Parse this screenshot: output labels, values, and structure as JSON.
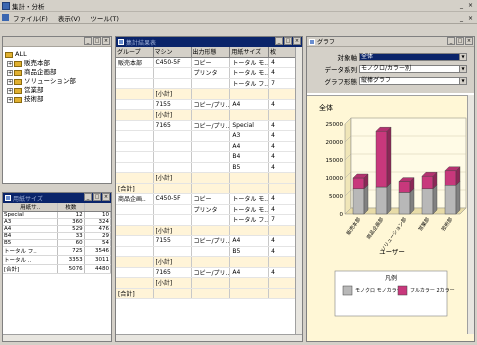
{
  "app": {
    "title": "集計・分析"
  },
  "menu": [
    "ファイル(F)",
    "表示(V)",
    "ツール(T)"
  ],
  "tree_window": {
    "nodes": [
      {
        "label": "ALL",
        "expander": ""
      },
      {
        "label": "販売本部",
        "expander": "+"
      },
      {
        "label": "商品企画部",
        "expander": "+"
      },
      {
        "label": "ソリューション部",
        "expander": "+"
      },
      {
        "label": "営業部",
        "expander": "+"
      },
      {
        "label": "技術部",
        "expander": "+"
      }
    ]
  },
  "summary_window": {
    "title": "用紙サイズ",
    "headers": [
      "用紙サ..",
      "枚数",
      ""
    ],
    "rows": [
      [
        "Special",
        "12",
        "10"
      ],
      [
        "A3",
        "360",
        "324"
      ],
      [
        "A4",
        "529",
        "476"
      ],
      [
        "B4",
        "33",
        "29"
      ],
      [
        "B5",
        "60",
        "54"
      ],
      [
        "トータル フ..",
        "725",
        "3546"
      ],
      [
        "トータル ..",
        "3353",
        "3011"
      ],
      [
        "[合計]",
        "5076",
        "4480"
      ]
    ]
  },
  "detail_window": {
    "title": "集計結果表",
    "headers": [
      "グループ",
      "マシン",
      "出力形態",
      "用紙サイズ",
      "枚"
    ],
    "rows": [
      [
        "販売本部",
        "C450-5F",
        "コピー",
        "トータル モ..",
        "4"
      ],
      [
        "",
        "",
        "プリンタ",
        "トータル モ..",
        "4"
      ],
      [
        "",
        "",
        "",
        "トータル フ..",
        "7"
      ],
      [
        "",
        "[小計]",
        "",
        "",
        ""
      ],
      [
        "",
        "7155",
        "コピー/プリ..",
        "A4",
        "4"
      ],
      [
        "",
        "[小計]",
        "",
        "",
        ""
      ],
      [
        "",
        "7165",
        "コピー/プリ..",
        "Special",
        "4"
      ],
      [
        "",
        "",
        "",
        "A3",
        "4"
      ],
      [
        "",
        "",
        "",
        "A4",
        "4"
      ],
      [
        "",
        "",
        "",
        "B4",
        "4"
      ],
      [
        "",
        "",
        "",
        "B5",
        "4"
      ],
      [
        "",
        "[小計]",
        "",
        "",
        ""
      ],
      [
        "[合計]",
        "",
        "",
        "",
        ""
      ],
      [
        "商品企画..",
        "C450-5F",
        "コピー",
        "トータル モ..",
        "4"
      ],
      [
        "",
        "",
        "プリンタ",
        "トータル モ..",
        "4"
      ],
      [
        "",
        "",
        "",
        "トータル フ..",
        "7"
      ],
      [
        "",
        "[小計]",
        "",
        "",
        ""
      ],
      [
        "",
        "7155",
        "コピー/プリ..",
        "A4",
        "4"
      ],
      [
        "",
        "",
        "",
        "B5",
        "4"
      ],
      [
        "",
        "[小計]",
        "",
        "",
        ""
      ],
      [
        "",
        "7165",
        "コピー/プリ..",
        "A4",
        "4"
      ],
      [
        "",
        "[小計]",
        "",
        "",
        ""
      ],
      [
        "[合計]",
        "",
        "",
        "",
        ""
      ]
    ]
  },
  "graph_window": {
    "title": "グラフ",
    "controls": [
      {
        "label": "対象軸",
        "value": "全体",
        "highlight": true
      },
      {
        "label": "データ系列",
        "value": "モノクロ/カラー別",
        "highlight": false
      },
      {
        "label": "グラフ形態",
        "value": "縦棒グラフ",
        "highlight": false
      }
    ]
  },
  "chart_data": {
    "type": "bar",
    "title": "全体",
    "xlabel": "ユーザー",
    "ylabel": "",
    "ylim": [
      0,
      25000
    ],
    "yticks": [
      0,
      5000,
      10000,
      15000,
      20000,
      25000
    ],
    "categories": [
      "販売本部",
      "商品企画部",
      "ソリューション部",
      "営業部",
      "技術部"
    ],
    "series": [
      {
        "name": "モノクロ モノカラー",
        "color": "#b8b8b8",
        "values": [
          7000,
          7500,
          6000,
          7000,
          8000
        ]
      },
      {
        "name": "フルカラー 2カラー",
        "color": "#c8387c",
        "values": [
          3000,
          15500,
          3000,
          3500,
          4000
        ]
      }
    ],
    "legend_title": "凡例",
    "legend_position": "bottom"
  }
}
